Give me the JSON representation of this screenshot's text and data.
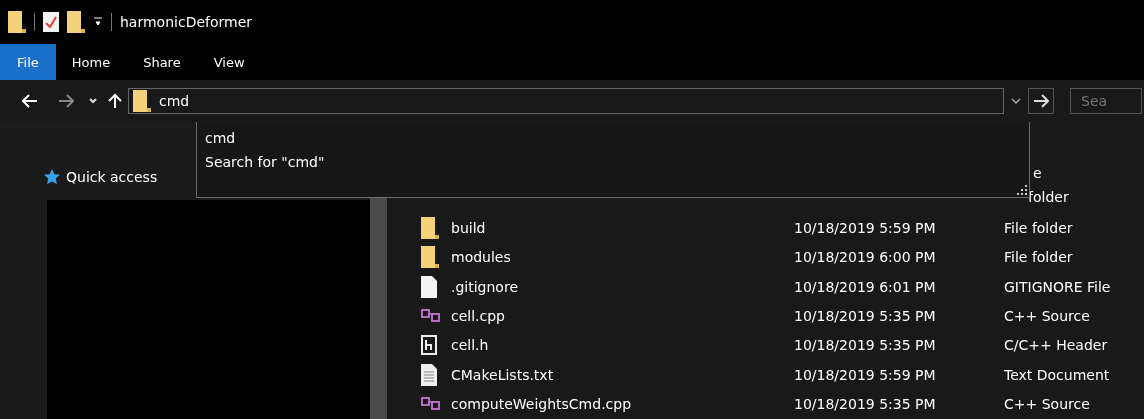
{
  "window": {
    "title": "harmonicDeformer"
  },
  "ribbon_tabs": [
    {
      "label": "File",
      "selected": true
    },
    {
      "label": "Home",
      "selected": false
    },
    {
      "label": "Share",
      "selected": false
    },
    {
      "label": "View",
      "selected": false
    }
  ],
  "address_bar": {
    "value": "cmd"
  },
  "search": {
    "placeholder": "Sea"
  },
  "suggestions": [
    "cmd",
    "Search for \"cmd\""
  ],
  "navigation": {
    "items": [
      {
        "label": "Quick access"
      }
    ]
  },
  "file_list": {
    "header_visible": "e",
    "partial_row_type": "folder",
    "rows": [
      {
        "kind": "folder",
        "name": "build",
        "date": "10/18/2019 5:59 PM",
        "type": "File folder"
      },
      {
        "kind": "folder",
        "name": "modules",
        "date": "10/18/2019 6:00 PM",
        "type": "File folder"
      },
      {
        "kind": "blank",
        "name": ".gitignore",
        "date": "10/18/2019 6:01 PM",
        "type": "GITIGNORE File"
      },
      {
        "kind": "cpp",
        "name": "cell.cpp",
        "date": "10/18/2019 5:35 PM",
        "type": "C++ Source"
      },
      {
        "kind": "header",
        "name": "cell.h",
        "date": "10/18/2019 5:35 PM",
        "type": "C/C++ Header"
      },
      {
        "kind": "text",
        "name": "CMakeLists.txt",
        "date": "10/18/2019 5:59 PM",
        "type": "Text Document"
      },
      {
        "kind": "cpp",
        "name": "computeWeightsCmd.cpp",
        "date": "10/18/2019 5:35 PM",
        "type": "C++ Source"
      }
    ]
  }
}
